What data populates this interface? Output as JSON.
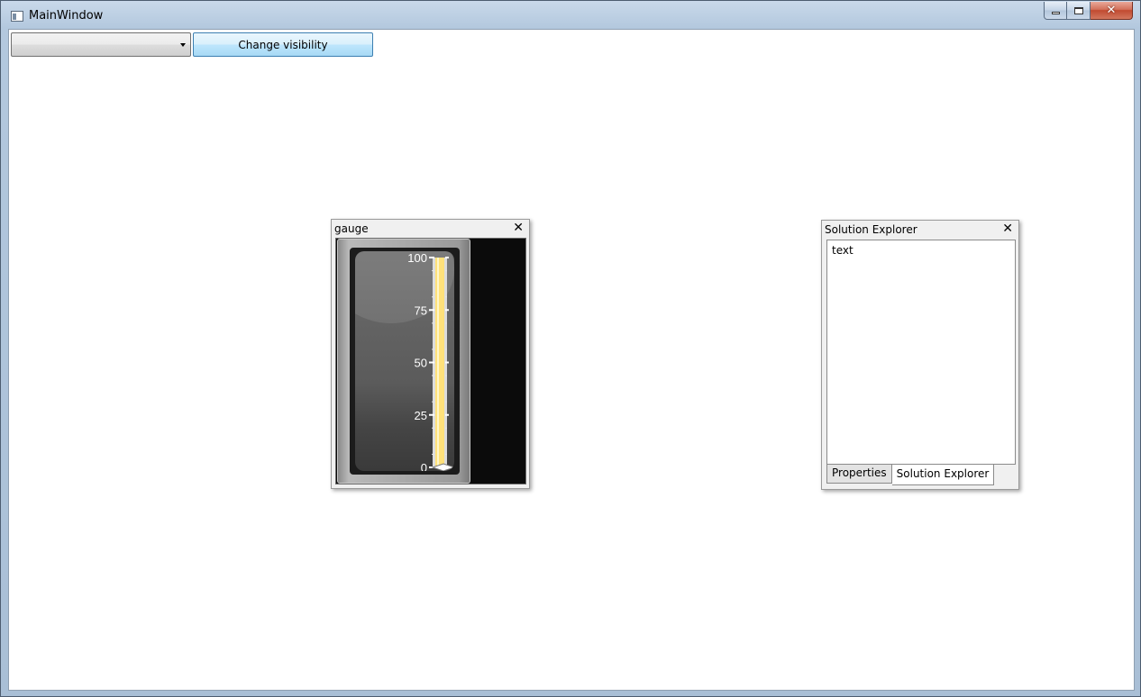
{
  "window": {
    "title": "MainWindow"
  },
  "toolbar": {
    "combo_value": "",
    "visibility_button_label": "Change visibility"
  },
  "gauge_pane": {
    "title": "gauge",
    "close_glyph": "✕",
    "scale_labels": [
      "100",
      "75",
      "50",
      "25",
      "0"
    ],
    "scale_min": 0,
    "scale_max": 100,
    "value": 100,
    "bar_color": "#ffe17a"
  },
  "solution_explorer": {
    "title": "Solution Explorer",
    "close_glyph": "✕",
    "content_text": "text",
    "tabs": [
      {
        "label": "Properties",
        "active": false
      },
      {
        "label": "Solution Explorer",
        "active": true
      }
    ]
  }
}
